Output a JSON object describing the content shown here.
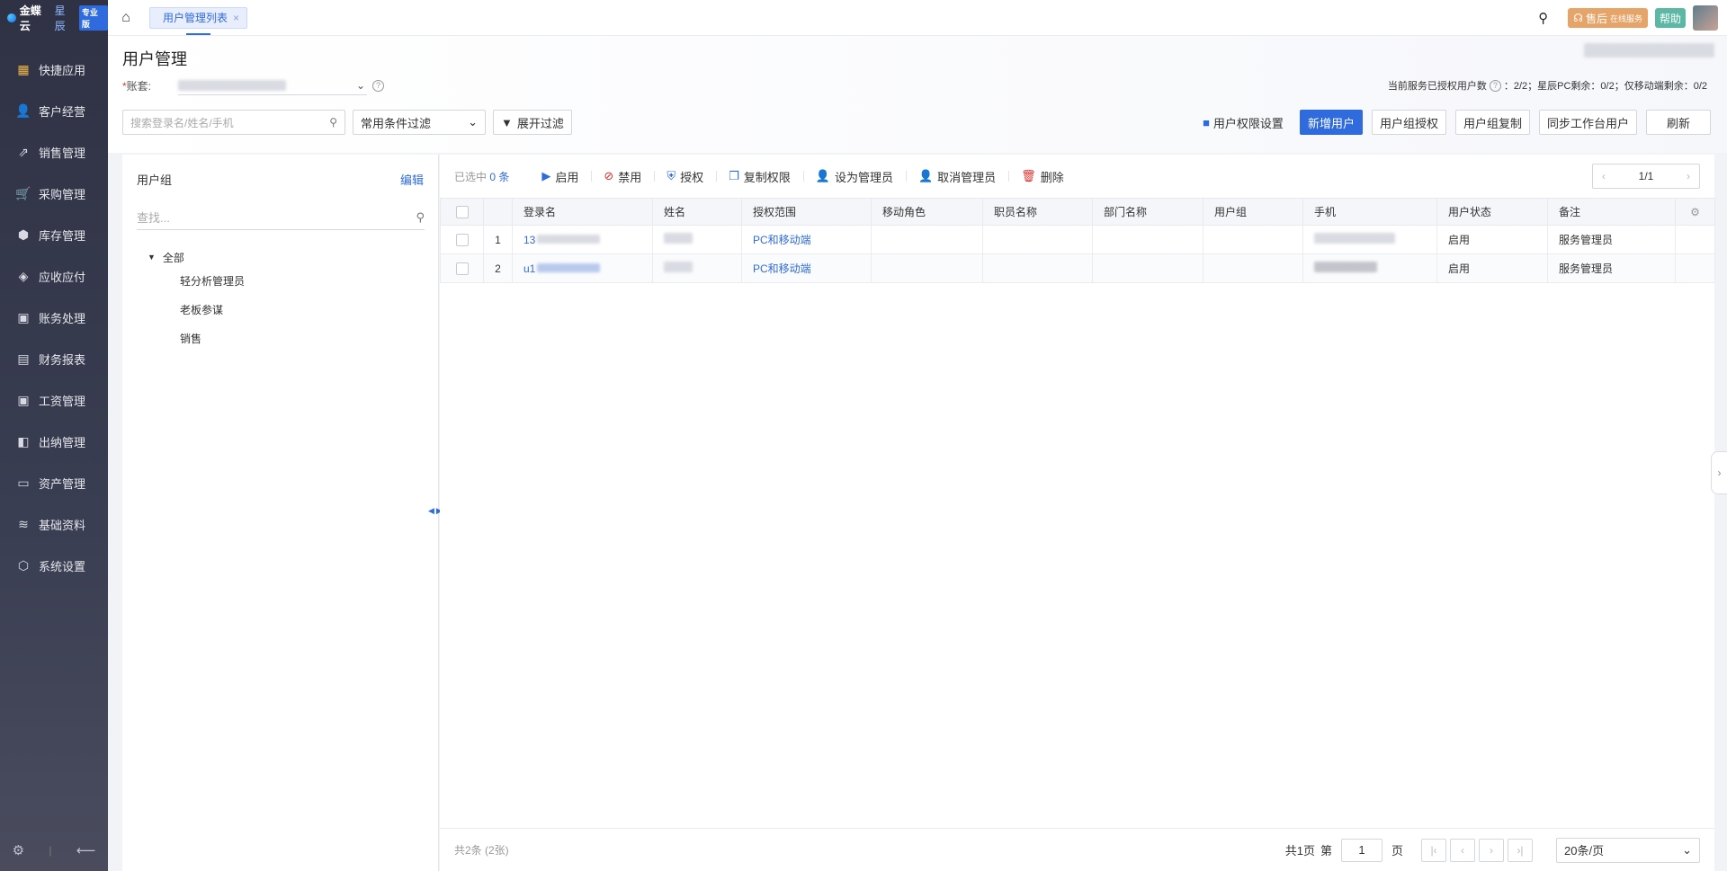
{
  "app": {
    "brand": "金蝶云",
    "brand2": "星辰",
    "edition": "专业版"
  },
  "sidebar": {
    "items": [
      {
        "label": "快捷应用",
        "icon": "grid-apps-icon"
      },
      {
        "label": "客户经营",
        "icon": "customer-icon"
      },
      {
        "label": "销售管理",
        "icon": "sales-icon"
      },
      {
        "label": "采购管理",
        "icon": "cart-icon"
      },
      {
        "label": "库存管理",
        "icon": "inventory-icon"
      },
      {
        "label": "应收应付",
        "icon": "receivable-icon"
      },
      {
        "label": "账务处理",
        "icon": "accounting-icon"
      },
      {
        "label": "财务报表",
        "icon": "report-icon"
      },
      {
        "label": "工资管理",
        "icon": "salary-icon"
      },
      {
        "label": "出纳管理",
        "icon": "cashier-icon"
      },
      {
        "label": "资产管理",
        "icon": "asset-icon"
      },
      {
        "label": "基础资料",
        "icon": "layers-icon"
      },
      {
        "label": "系统设置",
        "icon": "settings-icon"
      }
    ]
  },
  "topbar": {
    "tab_label": "用户管理列表",
    "service_label": "售后",
    "service_sub": "在线服务",
    "help_label": "帮助"
  },
  "header": {
    "title": "用户管理",
    "account_label": "账套:",
    "account_value": "",
    "license_info": "当前服务已授权用户数",
    "license_values": "2/2；星辰PC剩余：0/2；仅移动端剩余：0/2"
  },
  "filters": {
    "search_placeholder": "搜索登录名/姓名/手机",
    "common_filter": "常用条件过滤",
    "expand_filter": "展开过滤"
  },
  "actions": {
    "permission_settings": "用户权限设置",
    "add_user": "新增用户",
    "group_auth": "用户组授权",
    "group_copy": "用户组复制",
    "sync_users": "同步工作台用户",
    "refresh": "刷新"
  },
  "group_panel": {
    "title": "用户组",
    "edit": "编辑",
    "search_placeholder": "查找...",
    "root": "全部",
    "children": [
      "轻分析管理员",
      "老板参谋",
      "销售"
    ]
  },
  "toolbar": {
    "selected_prefix": "已选中",
    "selected_count": "0 条",
    "enable": "启用",
    "disable": "禁用",
    "authorize": "授权",
    "copy_perm": "复制权限",
    "set_admin": "设为管理员",
    "cancel_admin": "取消管理员",
    "delete": "删除",
    "page": "1/1"
  },
  "table": {
    "columns": [
      "登录名",
      "姓名",
      "授权范围",
      "移动角色",
      "职员名称",
      "部门名称",
      "用户组",
      "手机",
      "用户状态",
      "备注"
    ],
    "rows": [
      {
        "index": "1",
        "login": "13",
        "name": "",
        "scope": "PC和移动端",
        "mobile_role": "",
        "staff": "",
        "dept": "",
        "group": "",
        "phone": "",
        "status": "启用",
        "note": "服务管理员"
      },
      {
        "index": "2",
        "login": "u1",
        "name": "",
        "scope": "PC和移动端",
        "mobile_role": "",
        "staff": "",
        "dept": "",
        "group": "",
        "phone": "",
        "status": "启用",
        "note": "服务管理员"
      }
    ]
  },
  "footer": {
    "total": "共2条 (2张)",
    "total_pages": "共1页",
    "page_prefix": "第",
    "page_value": "1",
    "page_suffix": "页",
    "per_page": "20条/页"
  }
}
